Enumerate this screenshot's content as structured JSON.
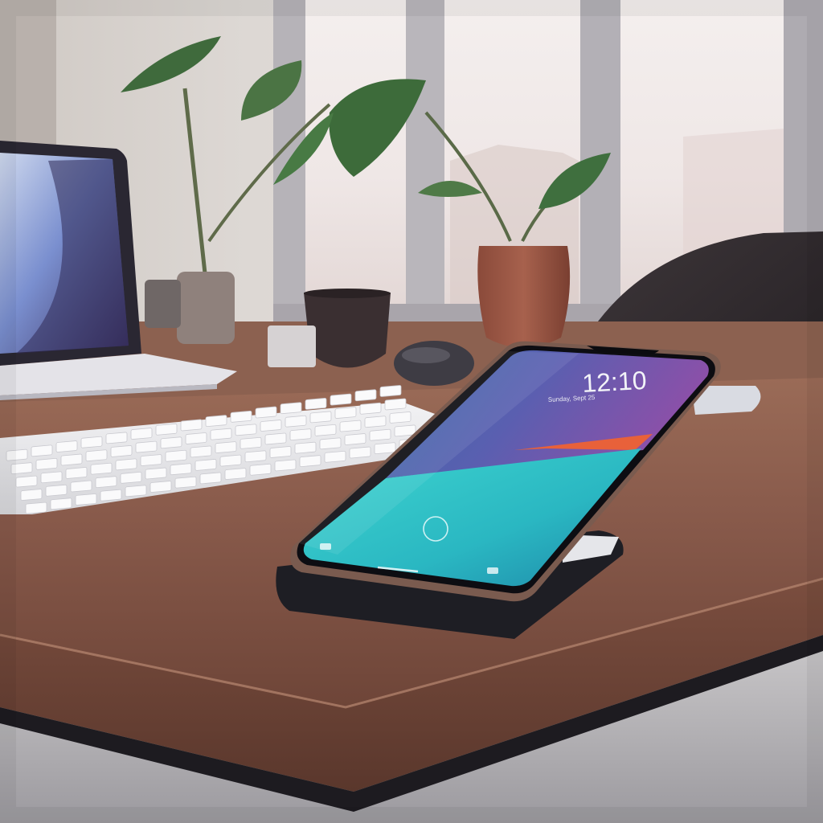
{
  "scene": {
    "phone": {
      "lockscreen_time": "12:10",
      "lockscreen_date": "Sunday, Sept 25"
    }
  }
}
